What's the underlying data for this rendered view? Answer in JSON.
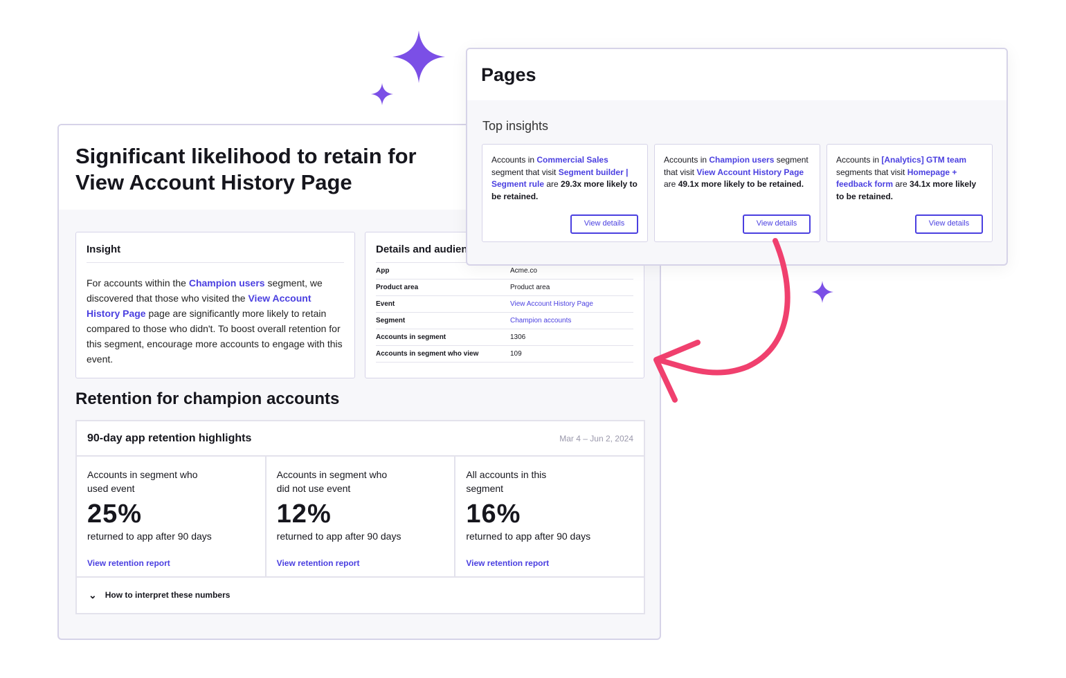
{
  "insight_page": {
    "title": "Significant likelihood to retain for View Account History Page",
    "insight": {
      "heading": "Insight",
      "t1": "For accounts within the ",
      "l1": "Champion users",
      "t2": " segment, we discovered that those who visited the ",
      "l2": "View Account History Page",
      "t3": " page are significantly more likely to retain compared to those who didn't. To boost overall retention for this segment, encourage more accounts to engage with this event."
    },
    "details": {
      "heading": "Details and audience",
      "rows": [
        {
          "key": "App",
          "value": "Acme.co"
        },
        {
          "key": "Product area",
          "value": "Product area"
        },
        {
          "key": "Event",
          "value": "View Account History Page"
        },
        {
          "key": "Segment",
          "value": "Champion accounts"
        },
        {
          "key": "Accounts in segment",
          "value": "1306"
        },
        {
          "key": "Accounts in segment who view",
          "value": "109"
        }
      ]
    },
    "retention_title": "Retention for champion accounts",
    "highlights": {
      "title": "90-day app retention highlights",
      "date_range": "Mar 4 – Jun 2, 2024",
      "stats": [
        {
          "label": "Accounts in segment who used event",
          "value": "25%",
          "sub": "returned to app after 90 days",
          "link": "View retention report"
        },
        {
          "label": "Accounts in segment who did not use event",
          "value": "12%",
          "sub": "returned to app after 90 days",
          "link": "View retention report"
        },
        {
          "label": "All accounts in this segment",
          "value": "16%",
          "sub": "returned to app after 90 days",
          "link": "View retention report"
        }
      ],
      "footer": "How to interpret these numbers"
    }
  },
  "pages_panel": {
    "title": "Pages",
    "section": "Top insights",
    "cards": [
      {
        "t1": "Accounts in ",
        "l1": "Commercial Sales",
        "t2": " segment that visit ",
        "l2": "Segment builder | Segment rule",
        "t3": " are ",
        "b": "29.3x more likely to be retained.",
        "button": "View details"
      },
      {
        "t1": "Accounts in ",
        "l1": "Champion users",
        "t2": " segment that visit ",
        "l2": "View Account History Page",
        "t3": " are ",
        "b": "49.1x more likely to be retained.",
        "button": "View details"
      },
      {
        "t1": "Accounts in ",
        "l1": "[Analytics] GTM team",
        "t2": " segments that visit ",
        "l2": "Homepage + feedback form",
        "t3": " are ",
        "b": "34.1x more likely to be retained.",
        "button": "View details"
      }
    ]
  },
  "colors": {
    "link": "#4a3fe0",
    "star": "#7b4fe6",
    "arrow": "#f0406e"
  }
}
